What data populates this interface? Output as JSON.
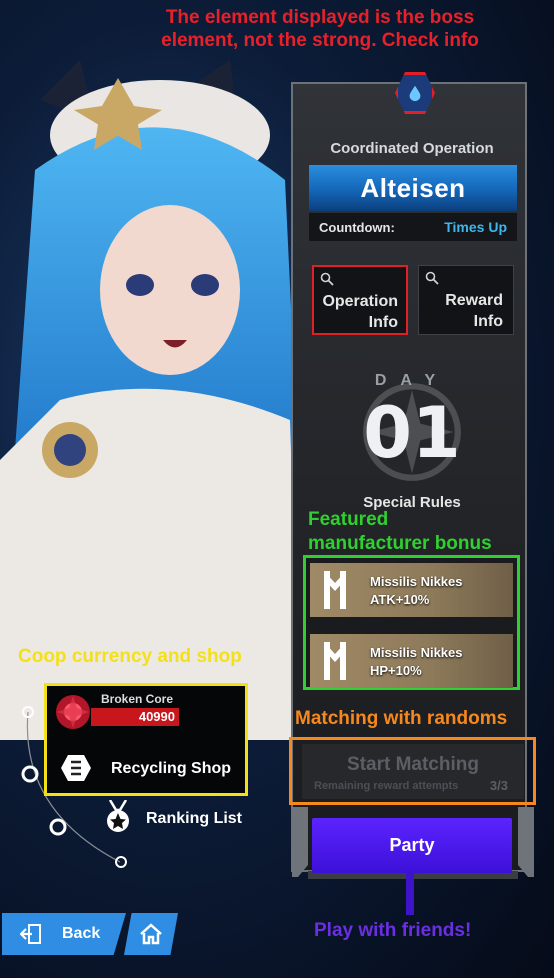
{
  "annotations": {
    "top_line1": "The element displayed is the boss",
    "top_line2": "element, not the strong. Check info",
    "manufacturer_line1": "Featured",
    "manufacturer_line2": "manufacturer bonus",
    "coop": "Coop currency and shop",
    "matching": "Matching with randoms",
    "party": "Play with friends!"
  },
  "colors": {
    "annotation_red": "#e8202a",
    "annotation_green": "#2fd02f",
    "annotation_yellow": "#f4e01a",
    "annotation_orange": "#f7881d",
    "annotation_purple": "#6a2fe0",
    "boss_bar": "#1466b8",
    "countdown_value": "#3db7ee",
    "party_button": "#4a18f0",
    "core_bar": "#c8161d",
    "bottom_buttons": "#2f8ee3"
  },
  "panel": {
    "element_icon": "water-drop-icon",
    "title": "Coordinated Operation",
    "boss_name": "Alteisen",
    "countdown_label": "Countdown:",
    "countdown_value": "Times Up",
    "operation_info_line1": "Operation",
    "operation_info_line2": "Info",
    "reward_info_line1": "Reward",
    "reward_info_line2": "Info",
    "day_label": "DAY",
    "day_number": "01",
    "special_rules": "Special Rules",
    "bonuses": [
      {
        "name": "Missilis Nikkes",
        "value": "ATK+10%"
      },
      {
        "name": "Missilis Nikkes",
        "value": "HP+10%"
      }
    ],
    "start_matching": "Start Matching",
    "remaining_label": "Remaining reward attempts",
    "remaining_value": "3/3",
    "party": "Party"
  },
  "coop": {
    "currency_name": "Broken Core",
    "currency_value": "40990",
    "shop_label": "Recycling Shop"
  },
  "ranking_label": "Ranking List",
  "nav": {
    "back_label": "Back",
    "home_icon": "home-icon"
  }
}
